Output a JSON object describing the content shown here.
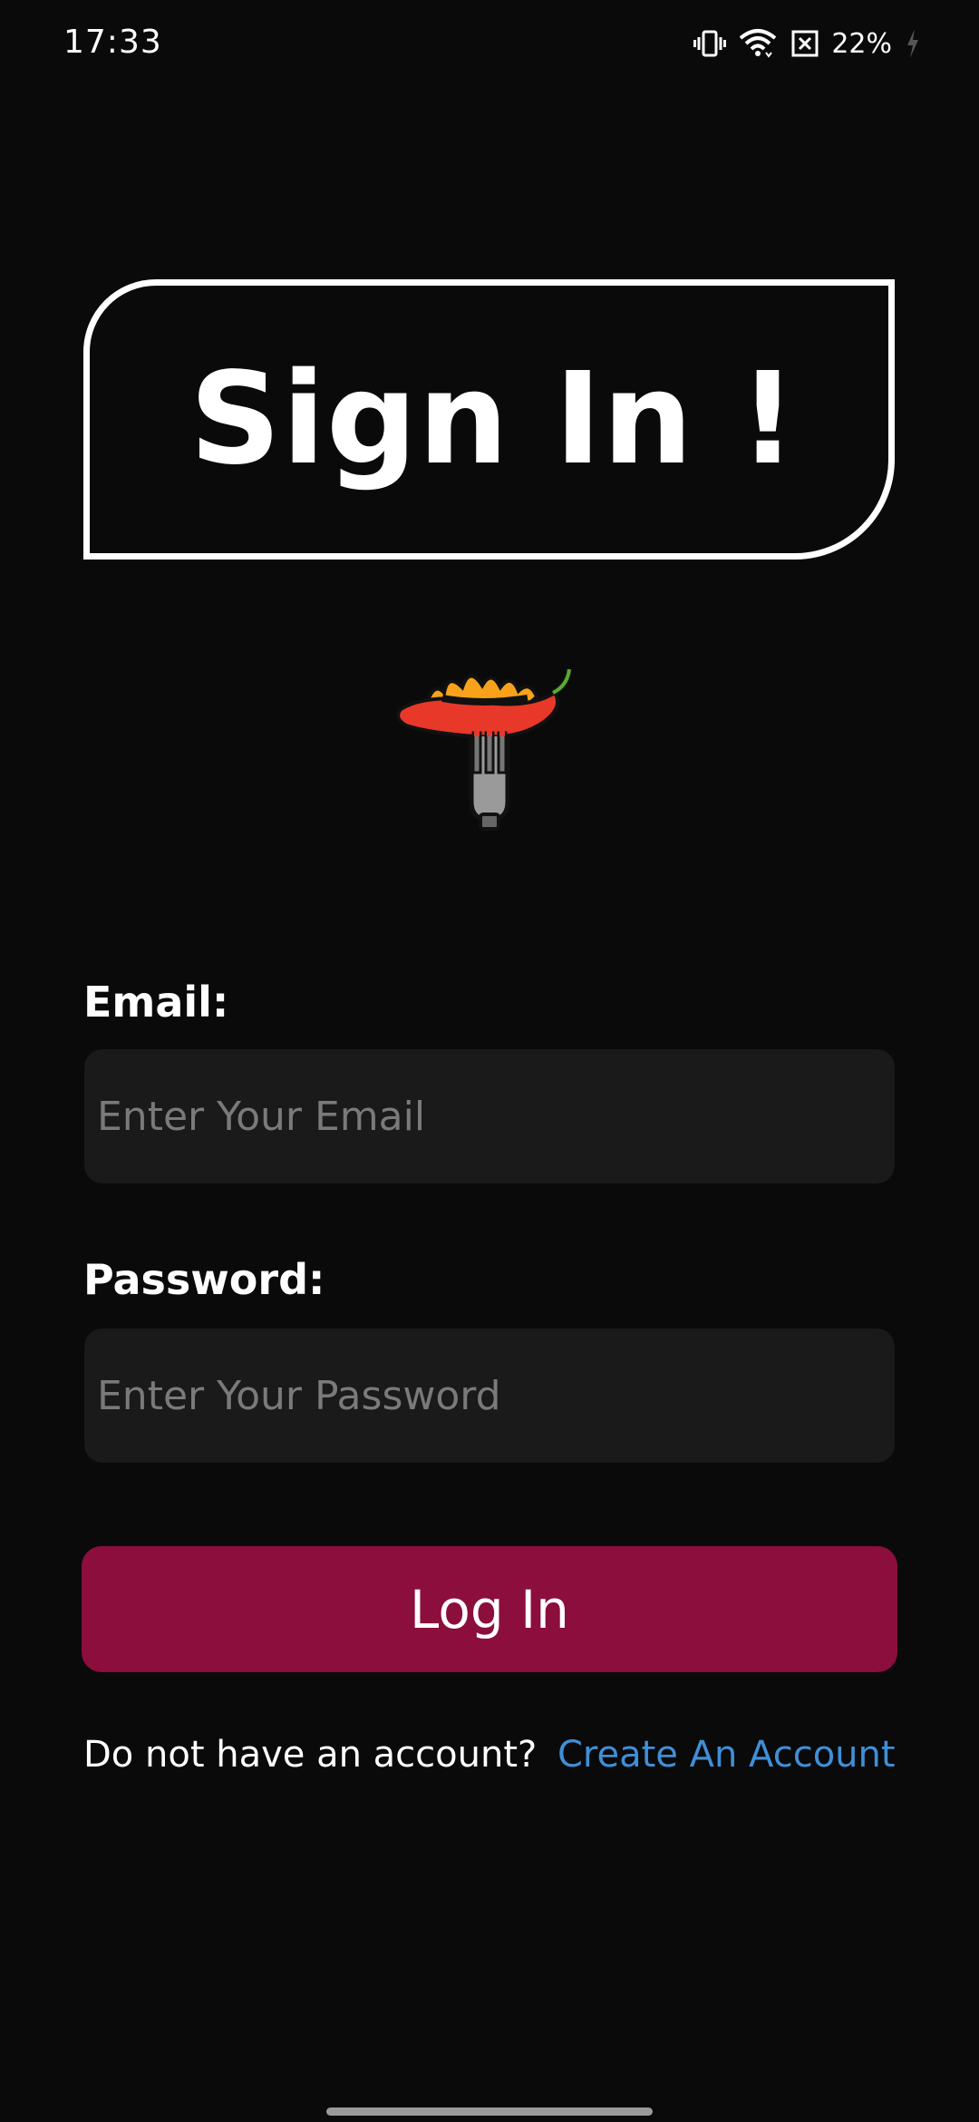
{
  "status_bar": {
    "time": "17:33",
    "battery_percent": "22%",
    "icons": [
      "vibrate-icon",
      "wifi-icon",
      "no-sim-icon",
      "battery-charging-icon"
    ]
  },
  "title": {
    "text": "Sign In !"
  },
  "logo": {
    "icon": "chili-fork-logo"
  },
  "form": {
    "email": {
      "label": "Email:",
      "placeholder": "Enter Your Email",
      "value": ""
    },
    "password": {
      "label": "Password:",
      "placeholder": "Enter Your Password",
      "value": ""
    },
    "login_label": "Log In"
  },
  "signup": {
    "prompt": "Do not have an account?",
    "link_label": "Create An Account"
  },
  "colors": {
    "background": "#0a0a0a",
    "input_background": "#1a1a1a",
    "button": "#8b0e3d",
    "link": "#3f8fd8"
  }
}
